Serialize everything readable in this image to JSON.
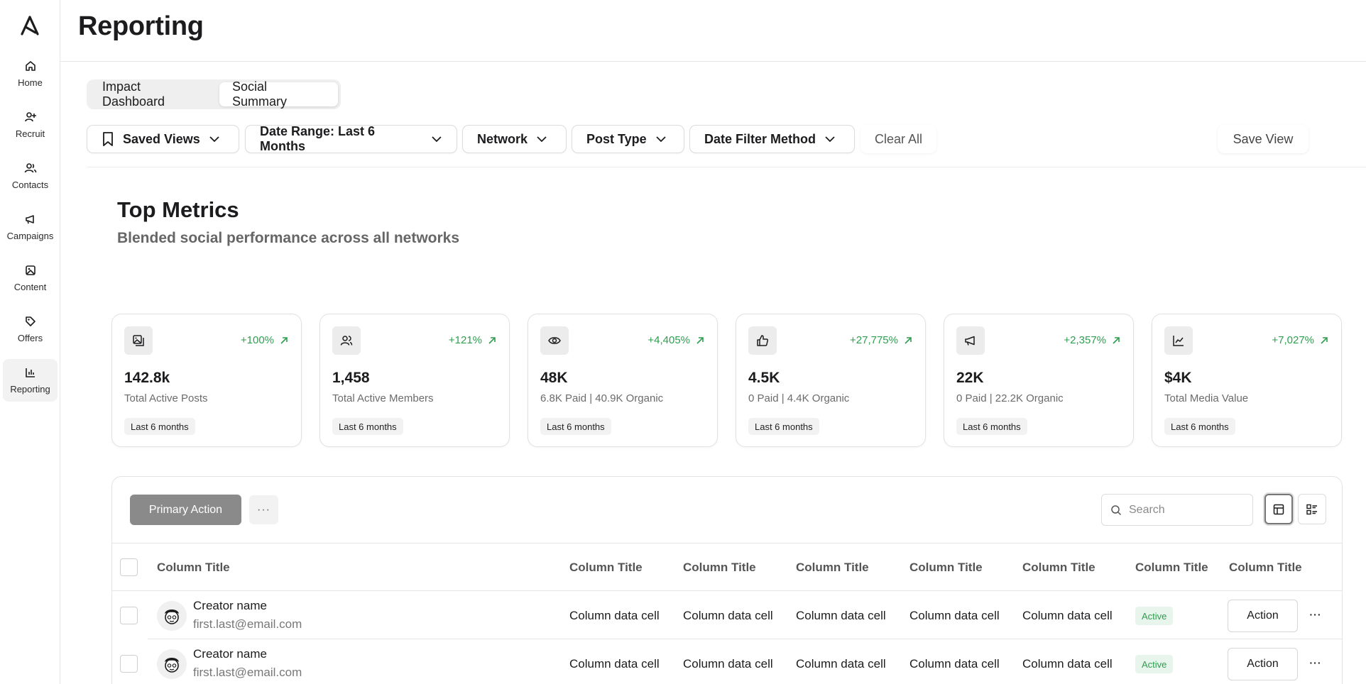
{
  "sidebar": {
    "items": [
      {
        "label": "Home",
        "icon": "home-icon"
      },
      {
        "label": "Recruit",
        "icon": "user-plus-icon"
      },
      {
        "label": "Contacts",
        "icon": "users-icon"
      },
      {
        "label": "Campaigns",
        "icon": "megaphone-icon"
      },
      {
        "label": "Content",
        "icon": "image-icon"
      },
      {
        "label": "Offers",
        "icon": "tag-icon"
      },
      {
        "label": "Reporting",
        "icon": "bar-chart-icon",
        "active": true
      }
    ]
  },
  "header": {
    "title": "Reporting"
  },
  "tabs": [
    {
      "label": "Impact Dashboard"
    },
    {
      "label": "Social Summary",
      "active": true
    }
  ],
  "filters": {
    "saved_views": "Saved Views",
    "date_range": "Date Range: Last 6 Months",
    "network": "Network",
    "post_type": "Post Type",
    "date_filter_method": "Date Filter Method",
    "clear_all": "Clear All",
    "save_view": "Save View"
  },
  "top_metrics": {
    "title": "Top Metrics",
    "subtitle": "Blended social performance across all networks",
    "cards": [
      {
        "change": "+100%",
        "value": "142.8k",
        "label": "Total Active Posts",
        "period": "Last 6 months",
        "icon": "posts-icon"
      },
      {
        "change": "+121%",
        "value": "1,458",
        "label": "Total Active Members",
        "period": "Last 6 months",
        "icon": "members-icon"
      },
      {
        "change": "+4,405%",
        "value": "48K",
        "label": "6.8K Paid | 40.9K Organic",
        "period": "Last 6 months",
        "icon": "eye-icon"
      },
      {
        "change": "+27,775%",
        "value": "4.5K",
        "label": "0 Paid | 4.4K Organic",
        "period": "Last 6 months",
        "icon": "thumbs-up-icon"
      },
      {
        "change": "+2,357%",
        "value": "22K",
        "label": "0 Paid | 22.2K Organic",
        "period": "Last 6 months",
        "icon": "megaphone-icon"
      },
      {
        "change": "+7,027%",
        "value": "$4K",
        "label": "Total Media Value",
        "period": "Last 6 months",
        "icon": "line-chart-icon"
      }
    ],
    "change_color": "#2e9e4f"
  },
  "table": {
    "primary_action": "Primary Action",
    "more": "···",
    "search_placeholder": "Search",
    "columns": [
      "Column Title",
      "Column Title",
      "Column Title",
      "Column Title",
      "Column Title",
      "Column Title",
      "Column Title",
      "Column Title"
    ],
    "rows": [
      {
        "name": "Creator name",
        "email": "first.last@email.com",
        "cells": [
          "Column data cell",
          "Column data cell",
          "Column data cell",
          "Column data cell",
          "Column data cell"
        ],
        "status": "Active",
        "action": "Action",
        "more": "···"
      },
      {
        "name": "Creator name",
        "email": "first.last@email.com",
        "cells": [
          "Column data cell",
          "Column data cell",
          "Column data cell",
          "Column data cell",
          "Column data cell"
        ],
        "status": "Active",
        "action": "Action",
        "more": "···"
      }
    ]
  }
}
